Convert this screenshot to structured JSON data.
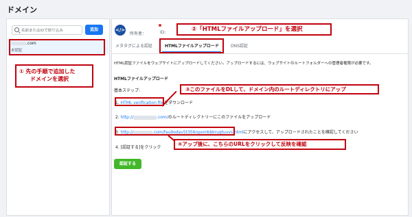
{
  "page": {
    "title": "ドメイン"
  },
  "sidebar": {
    "search_placeholder": "名前またはIDで絞り込み",
    "add_button": "追加",
    "domain_item": {
      "name": ".com",
      "status": "未認証"
    }
  },
  "header": {
    "avatar_glyph": "</>",
    "owner_label": "所有者：",
    "id_label": "ID:"
  },
  "tabs": [
    {
      "label": "メタタグによる認証"
    },
    {
      "label": "HTMLファイルアップロード"
    },
    {
      "label": "DNS認証"
    }
  ],
  "content": {
    "intro": "HTML認証ファイルをウェブサイトにアップロードしてください。アップロードするには、ウェブサイトのルートフォルダーへの管理者権限が必要です。",
    "section_heading": "HTMLファイルアップロード",
    "steps_label": "基本ステップ:",
    "steps": [
      {
        "number": "1.",
        "link": "HTML verification file",
        "text": "をダウンロード"
      },
      {
        "number": "2.",
        "link": "http://",
        "link_tail": ".com/",
        "text": "のルートディレクトリーにこのファイルをアップロード"
      },
      {
        "number": "3.",
        "link": "http://",
        "link_tail": ".com/fau9odav5t356npxmbbkrugtuvvs.html",
        "text": "にアクセスして、アップロードされたことを確認してください"
      },
      {
        "number": "4.",
        "text": "[認証する]をクリック"
      }
    ],
    "confirm_button": "認証する"
  },
  "annotations": {
    "callout_1_line1": "① 先の手順で追加した",
    "callout_1_line2": "ドメインを選択",
    "callout_2": "②「HTMLファイルアップロード」を選択",
    "callout_3": "③このファイルをDLして、ドメイン内のルートディレクトリにアップ",
    "callout_4": "④アップ後に、こちらのURLをクリックして反映を確認",
    "color": "#c0000c"
  },
  "colors": {
    "accent": "#1877f2",
    "confirm": "#42b72a",
    "background": "#f0f2f5"
  }
}
